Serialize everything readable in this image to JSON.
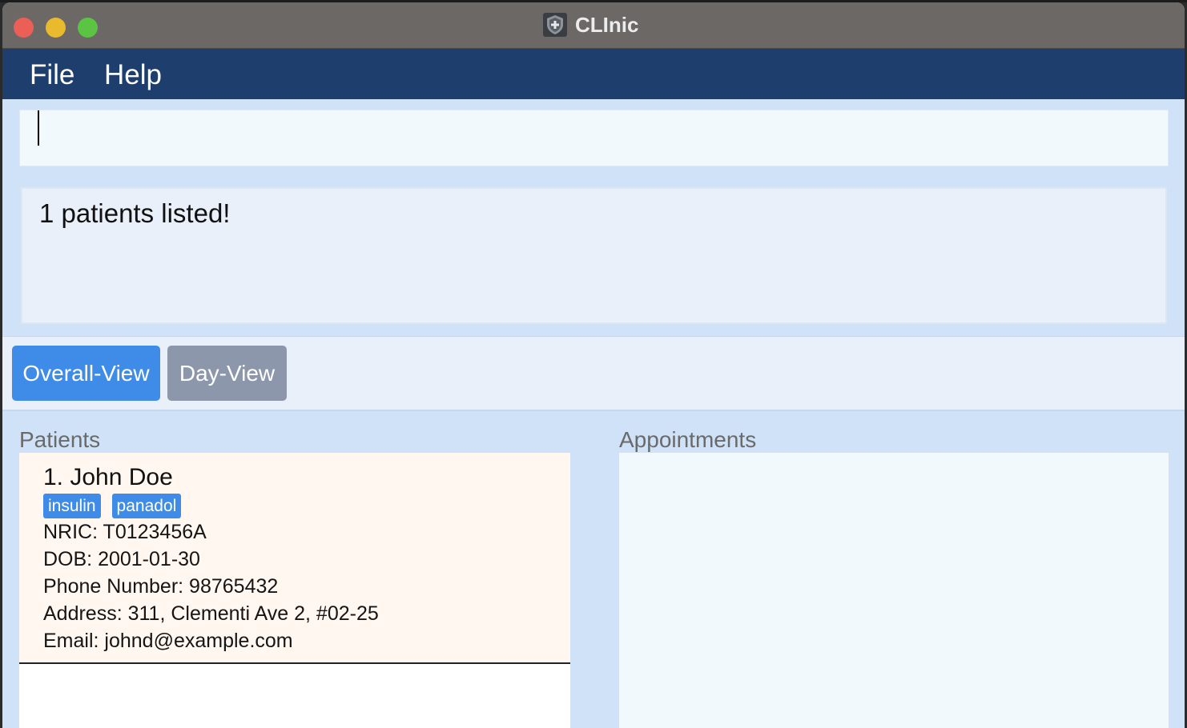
{
  "window": {
    "title": "CLInic"
  },
  "menu": {
    "file": "File",
    "help": "Help"
  },
  "command": {
    "value": ""
  },
  "result": {
    "message": "1 patients listed!"
  },
  "tabs": {
    "overall": "Overall-View",
    "day": "Day-View",
    "active": "Overall-View"
  },
  "panels": {
    "patients_label": "Patients",
    "appointments_label": "Appointments"
  },
  "patients": [
    {
      "index_name": "1.  John Doe",
      "tags": [
        "insulin",
        "panadol"
      ],
      "nric": "NRIC: T0123456A",
      "dob": "DOB: 2001-01-30",
      "phone": "Phone Number: 98765432",
      "address": "Address: 311, Clementi Ave 2, #02-25",
      "email": "Email: johnd@example.com"
    }
  ],
  "appointments": [],
  "colors": {
    "menubar": "#1e3f6e",
    "accent": "#3e8ce8",
    "tab_inactive": "#8d97ab",
    "background": "#cfe2f7",
    "patient_card": "#fff7f0"
  },
  "icons": {
    "app": "shield-cross-icon"
  }
}
